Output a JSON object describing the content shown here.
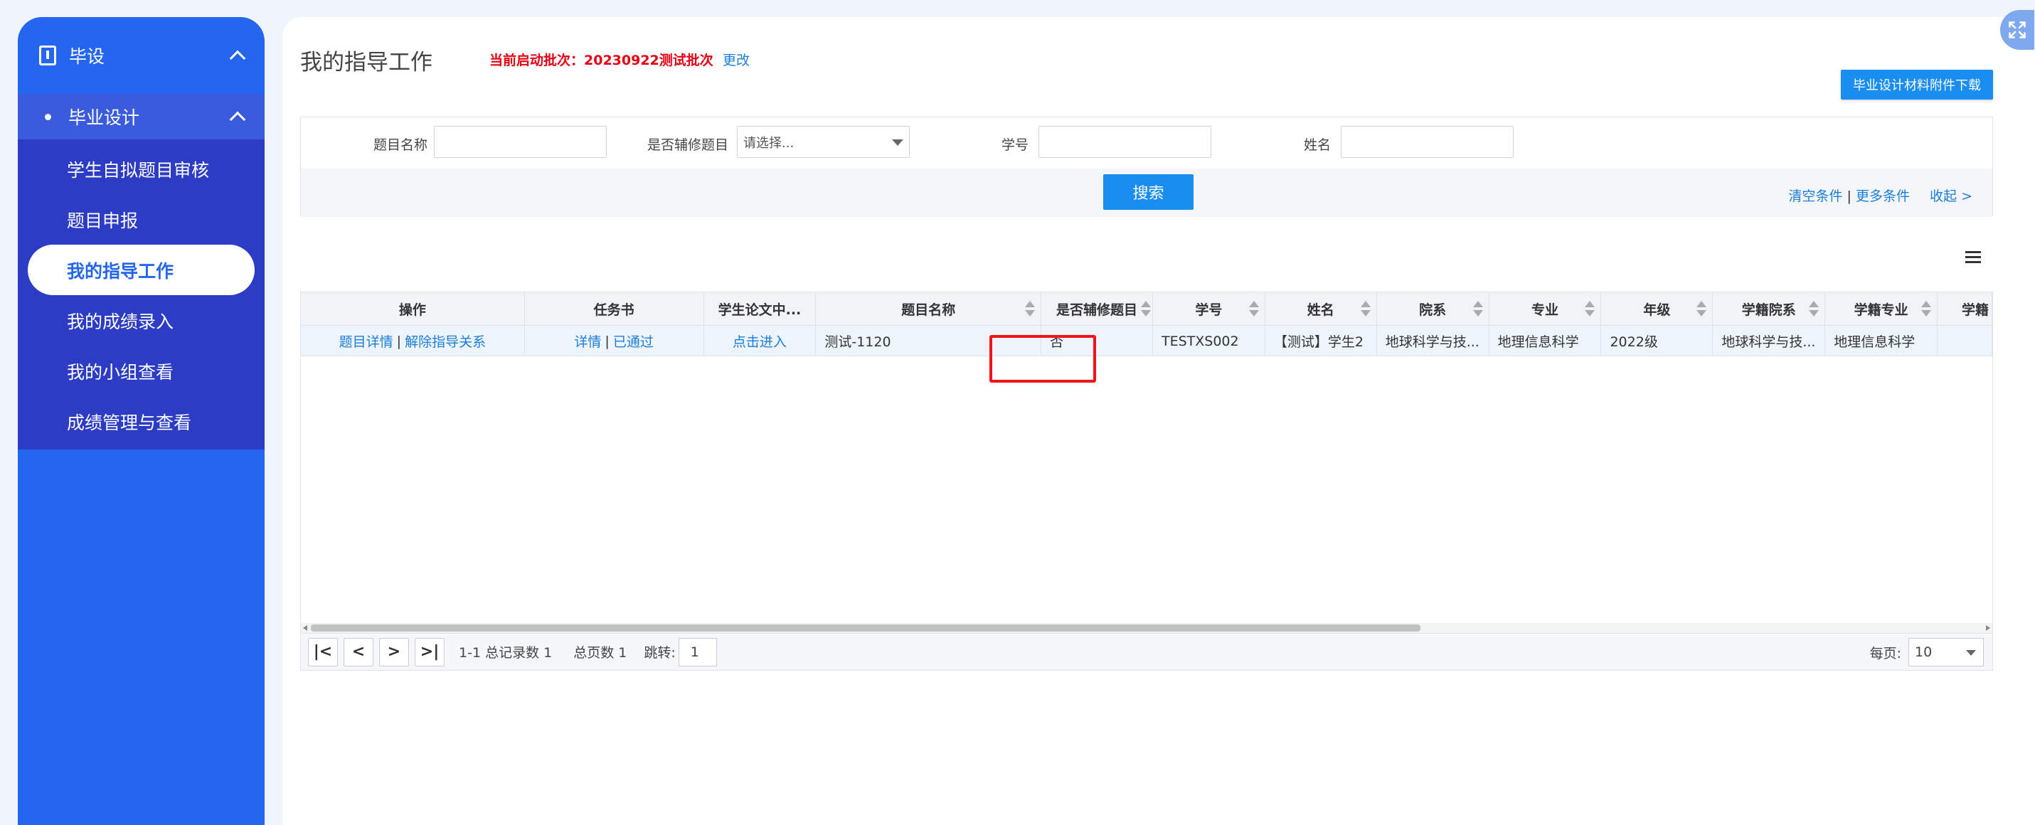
{
  "sidebar": {
    "top_title": "毕设",
    "sub_title": "毕业设计",
    "items": [
      {
        "label": "学生自拟题目审核"
      },
      {
        "label": "题目申报"
      },
      {
        "label": "我的指导工作"
      },
      {
        "label": "我的成绩录入"
      },
      {
        "label": "我的小组查看"
      },
      {
        "label": "成绩管理与查看"
      }
    ],
    "active_index": 2
  },
  "header": {
    "title": "我的指导工作",
    "batch": "当前启动批次：20230922测试批次",
    "change_link": "更改",
    "download_button": "毕业设计材料附件下载"
  },
  "filter": {
    "topic_label": "题目名称",
    "minor_label": "是否辅修题目",
    "minor_select": "请选择...",
    "student_id_label": "学号",
    "name_label": "姓名",
    "search_button": "搜索",
    "clear_link": "清空条件",
    "sep": "|",
    "more_link": "更多条件",
    "collapse_link": "收起 >"
  },
  "table": {
    "columns": [
      "操作",
      "任务书",
      "学生论文中...",
      "题目名称",
      "是否辅修题目",
      "学号",
      "姓名",
      "院系",
      "专业",
      "年级",
      "学籍院系",
      "学籍专业",
      "学籍"
    ],
    "row": {
      "op_detail": "题目详情",
      "op_sep": "|",
      "op_release": "解除指导关系",
      "task_detail": "详情",
      "task_sep": "|",
      "task_status": "已通过",
      "enter": "点击进入",
      "topic": "测试-1120",
      "minor": "否",
      "student_id": "TESTXS002",
      "name": "【测试】学生2",
      "department": "地球科学与技...",
      "major": "地理信息科学",
      "grade": "2022级",
      "reg_department": "地球科学与技...",
      "reg_major": "地理信息科学",
      "reg_extra": ""
    }
  },
  "pager": {
    "first": "|<",
    "prev": "<",
    "next": ">",
    "last": ">|",
    "range": "1-1 总记录数 1",
    "pages": "总页数 1",
    "jump_label": "跳转:",
    "jump_value": "1",
    "per_page_label": "每页:",
    "per_page_value": "10"
  }
}
